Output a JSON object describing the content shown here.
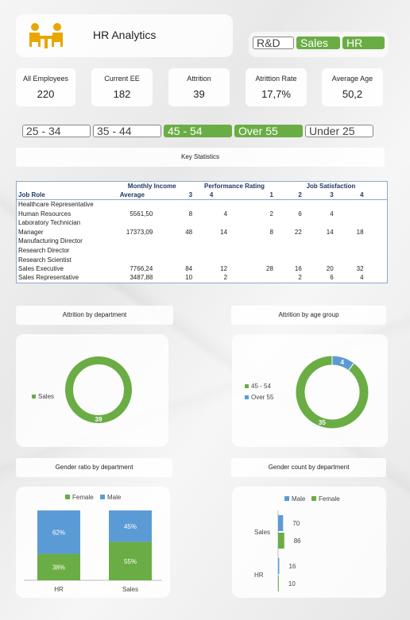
{
  "header": {
    "title": "HR Analytics",
    "logo_icon": "meeting-people-icon"
  },
  "dept_slicer": [
    {
      "label": "R&D",
      "selected": false
    },
    {
      "label": "Sales",
      "selected": true
    },
    {
      "label": "HR",
      "selected": true
    }
  ],
  "kpis": [
    {
      "label": "All Employees",
      "value": "220"
    },
    {
      "label": "Current EE",
      "value": "182"
    },
    {
      "label": "Attrition",
      "value": "39"
    },
    {
      "label": "Atrittion Rate",
      "value": "17,7%"
    },
    {
      "label": "Average Age",
      "value": "50,2"
    }
  ],
  "age_slicer": [
    {
      "label": "25 - 34",
      "selected": false
    },
    {
      "label": "35 - 44",
      "selected": false
    },
    {
      "label": "45 - 54",
      "selected": true
    },
    {
      "label": "Over 55",
      "selected": true
    },
    {
      "label": "Under 25",
      "selected": false
    }
  ],
  "key_stats": {
    "title": "Key Statistics",
    "header_groups": {
      "income": "Monthly Income",
      "perf": "Performance Rating",
      "sat": "Job Satisfaction"
    },
    "header_cols": {
      "role": "Job Role",
      "avg": "Average",
      "p3": "3",
      "p4": "4",
      "s1": "1",
      "s2": "2",
      "s3": "3",
      "s4": "4"
    },
    "rows": [
      {
        "role": "Healthcare Representative",
        "avg": "",
        "p3": "",
        "p4": "",
        "s1": "",
        "s2": "",
        "s3": "",
        "s4": ""
      },
      {
        "role": "Human Resources",
        "avg": "5561,50",
        "p3": "8",
        "p4": "4",
        "s1": "2",
        "s2": "6",
        "s3": "4",
        "s4": ""
      },
      {
        "role": "Laboratory Technician",
        "avg": "",
        "p3": "",
        "p4": "",
        "s1": "",
        "s2": "",
        "s3": "",
        "s4": ""
      },
      {
        "role": "Manager",
        "avg": "17373,09",
        "p3": "48",
        "p4": "14",
        "s1": "8",
        "s2": "22",
        "s3": "14",
        "s4": "18"
      },
      {
        "role": "Manufacturing Director",
        "avg": "",
        "p3": "",
        "p4": "",
        "s1": "",
        "s2": "",
        "s3": "",
        "s4": ""
      },
      {
        "role": "Research Director",
        "avg": "",
        "p3": "",
        "p4": "",
        "s1": "",
        "s2": "",
        "s3": "",
        "s4": ""
      },
      {
        "role": "Research Scientist",
        "avg": "",
        "p3": "",
        "p4": "",
        "s1": "",
        "s2": "",
        "s3": "",
        "s4": ""
      },
      {
        "role": "Sales Executive",
        "avg": "7766,24",
        "p3": "84",
        "p4": "12",
        "s1": "28",
        "s2": "16",
        "s3": "20",
        "s4": "32"
      },
      {
        "role": "Sales Representative",
        "avg": "3487,88",
        "p3": "10",
        "p4": "2",
        "s1": "",
        "s2": "2",
        "s3": "6",
        "s4": "4"
      }
    ]
  },
  "colors": {
    "green": "#6aad45",
    "blue": "#5b9bd5"
  },
  "chart_titles": {
    "attr_dept": "Attrition by department",
    "attr_age": "Attrition by age group",
    "gender_ratio": "Gender ratio by department",
    "gender_count": "Gender count by department"
  },
  "chart_data": [
    {
      "type": "pie",
      "title": "Attrition by department",
      "donut": true,
      "slices": [
        {
          "label": "Sales",
          "value": 39
        }
      ],
      "legend": "left"
    },
    {
      "type": "pie",
      "title": "Attrition by age group",
      "donut": true,
      "slices": [
        {
          "label": "45 - 54",
          "value": 35
        },
        {
          "label": "Over 55",
          "value": 4
        }
      ],
      "legend": "left"
    },
    {
      "type": "bar",
      "stacked": "percent",
      "title": "Gender ratio by department",
      "categories": [
        "HR",
        "Sales"
      ],
      "series": [
        {
          "name": "Female",
          "values": [
            38,
            55
          ],
          "labels": [
            "38%",
            "55%"
          ]
        },
        {
          "name": "Male",
          "values": [
            62,
            45
          ],
          "labels": [
            "62%",
            "45%"
          ]
        }
      ],
      "legend": "top"
    },
    {
      "type": "bar",
      "orientation": "horizontal",
      "title": "Gender count by department",
      "categories": [
        "Sales",
        "HR"
      ],
      "series": [
        {
          "name": "Male",
          "values": [
            70,
            16
          ]
        },
        {
          "name": "Female",
          "values": [
            86,
            10
          ]
        }
      ],
      "legend": "top"
    }
  ]
}
